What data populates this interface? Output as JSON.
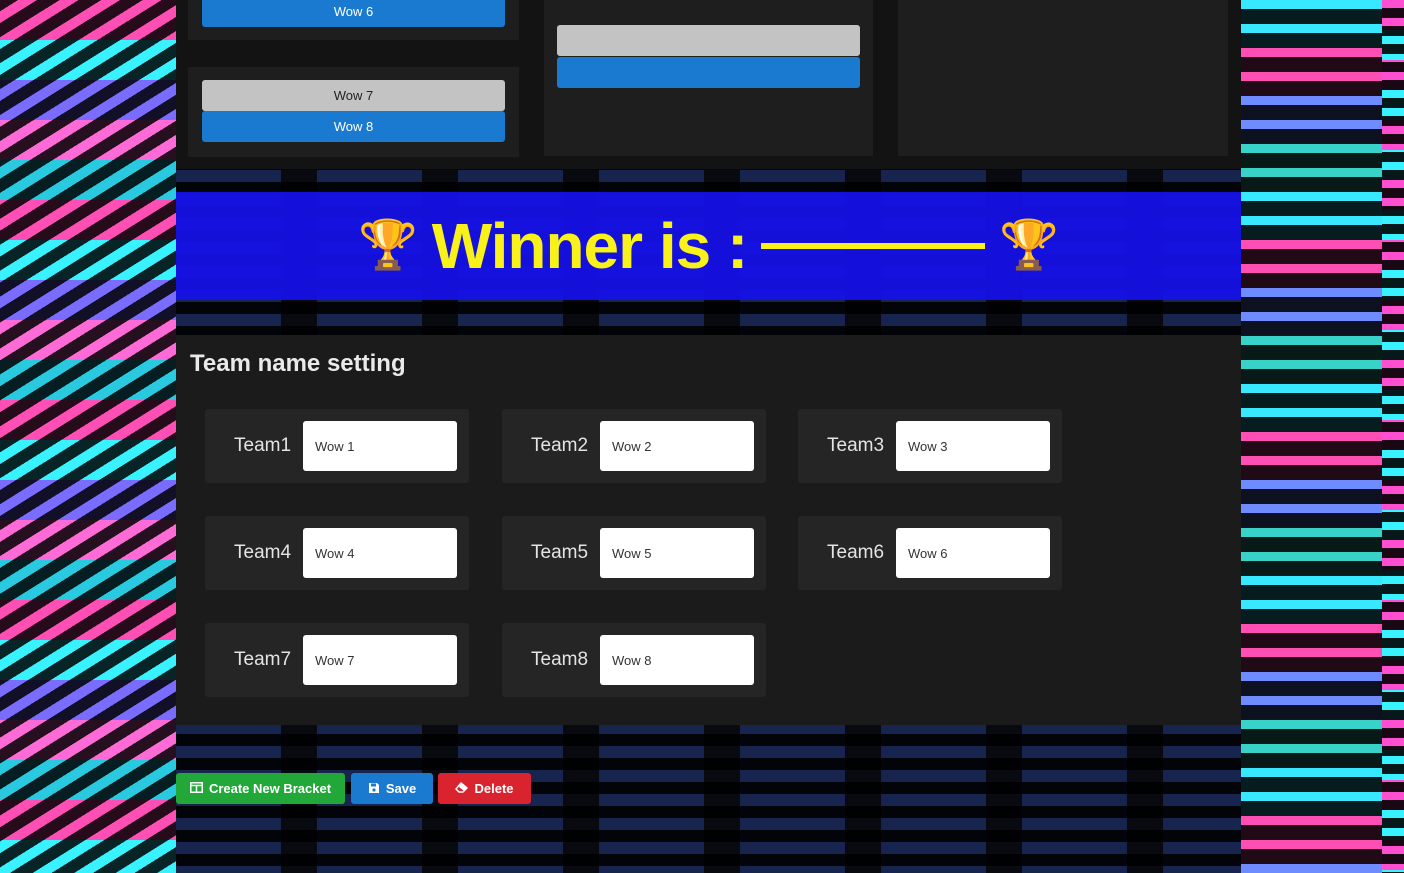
{
  "bracket": {
    "round1_visible": [
      {
        "team_a": "",
        "team_b": "Wow 6"
      },
      {
        "team_a": "Wow 7",
        "team_b": "Wow 8"
      }
    ],
    "round2_visible": [
      {
        "team_a": "",
        "team_b": ""
      }
    ]
  },
  "winner": {
    "label": "Winner is :",
    "trophy_icon": "🏆",
    "color": "#f9f21a",
    "banner_color": "#1610ea"
  },
  "team_settings": {
    "title": "Team name setting",
    "teams": [
      {
        "label": "Team1",
        "value": "Wow 1"
      },
      {
        "label": "Team2",
        "value": "Wow 2"
      },
      {
        "label": "Team3",
        "value": "Wow 3"
      },
      {
        "label": "Team4",
        "value": "Wow 4"
      },
      {
        "label": "Team5",
        "value": "Wow 5"
      },
      {
        "label": "Team6",
        "value": "Wow 6"
      },
      {
        "label": "Team7",
        "value": "Wow 7"
      },
      {
        "label": "Team8",
        "value": "Wow 8"
      }
    ]
  },
  "actions": {
    "create_label": "Create New Bracket",
    "create_icon": "table-icon",
    "save_label": "Save",
    "save_icon": "floppy-disk-icon",
    "delete_label": "Delete",
    "delete_icon": "eraser-icon",
    "colors": {
      "create": "#21a839",
      "save": "#1a7ad0",
      "delete": "#d9232f"
    }
  }
}
